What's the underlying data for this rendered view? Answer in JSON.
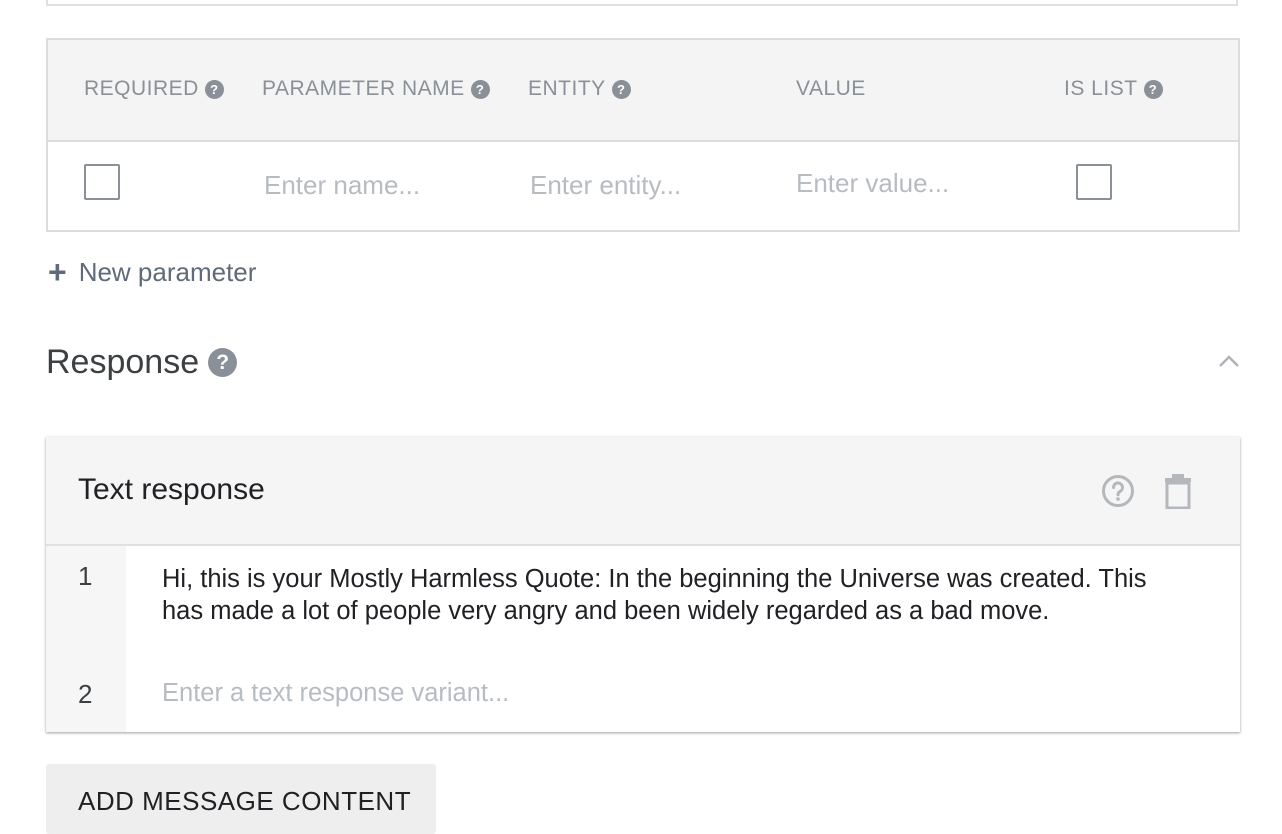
{
  "parameters": {
    "columns": [
      {
        "label": "REQUIRED",
        "help": true
      },
      {
        "label": "PARAMETER NAME",
        "help": true
      },
      {
        "label": "ENTITY",
        "help": true
      },
      {
        "label": "VALUE",
        "help": false
      },
      {
        "label": "IS LIST",
        "help": true
      }
    ],
    "row": {
      "required_checked": false,
      "name_placeholder": "Enter name...",
      "entity_placeholder": "Enter entity...",
      "value_placeholder": "Enter value...",
      "is_list_checked": false
    },
    "new_parameter_label": "New parameter"
  },
  "response": {
    "title": "Response",
    "text_response": {
      "title": "Text response",
      "variants": [
        {
          "number": "1",
          "text": "Hi, this is your Mostly Harmless Quote: In the beginning the Universe was created. This has made a lot of people very angry and been widely regarded as a bad move."
        },
        {
          "number": "2",
          "placeholder": "Enter a text response variant..."
        }
      ]
    }
  },
  "add_message_content_label": "ADD MESSAGE CONTENT",
  "icons": {
    "help": "question-circle-icon",
    "delete": "trash-icon",
    "collapse": "chevron-up-icon",
    "add": "plus-icon"
  }
}
